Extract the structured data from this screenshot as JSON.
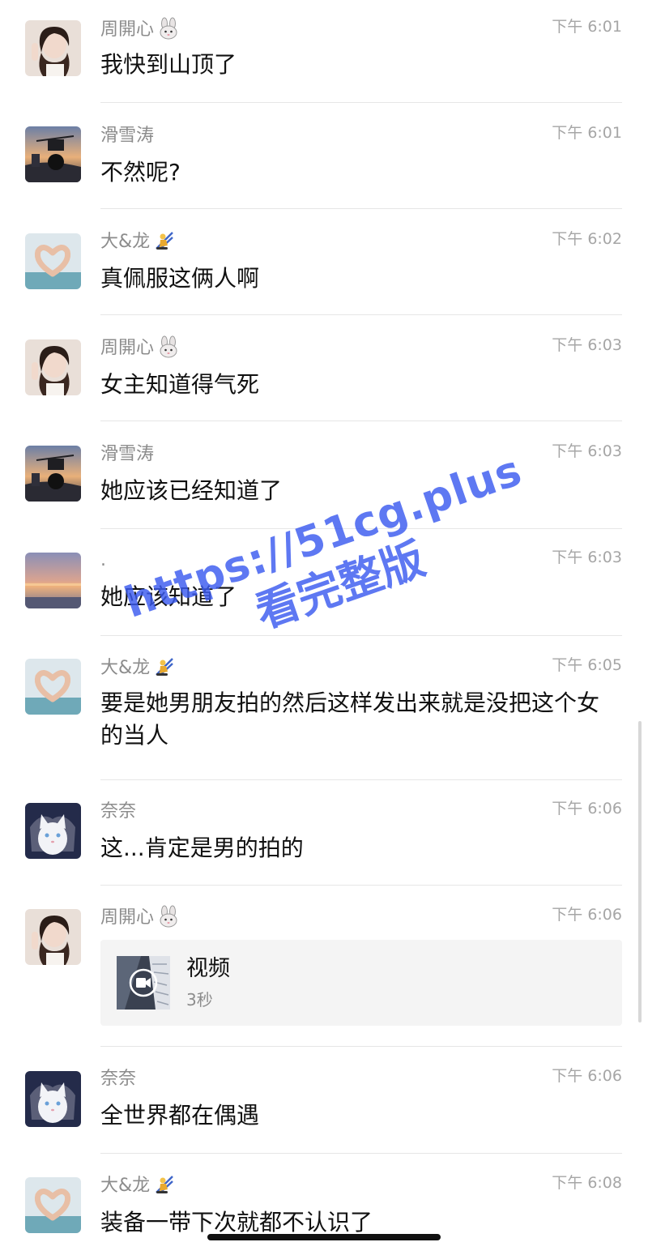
{
  "messages": [
    {
      "sender": "周開心",
      "sender_emoji": "rabbit-emoji",
      "time": "下午 6:01",
      "type": "text",
      "text": "我快到山顶了",
      "avatar": "avatar-girl"
    },
    {
      "sender": "滑雪涛",
      "sender_emoji": "",
      "time": "下午 6:01",
      "type": "text",
      "text": "不然呢?",
      "avatar": "avatar-ski-sunset"
    },
    {
      "sender": "大&龙",
      "sender_emoji": "skier-emoji",
      "time": "下午 6:02",
      "type": "text",
      "text": "真佩服这俩人啊",
      "avatar": "avatar-heart-hands"
    },
    {
      "sender": "周開心",
      "sender_emoji": "rabbit-emoji",
      "time": "下午 6:03",
      "type": "text",
      "text": "女主知道得气死",
      "avatar": "avatar-girl"
    },
    {
      "sender": "滑雪涛",
      "sender_emoji": "",
      "time": "下午 6:03",
      "type": "text",
      "text": "她应该已经知道了",
      "avatar": "avatar-ski-sunset"
    },
    {
      "sender": ".",
      "sender_emoji": "",
      "time": "下午 6:03",
      "type": "text",
      "text": "她应该知道了",
      "avatar": "avatar-sunset-sea"
    },
    {
      "sender": "大&龙",
      "sender_emoji": "skier-emoji",
      "time": "下午 6:05",
      "type": "text",
      "text": "要是她男朋友拍的然后这样发出来就是没把这个女的当人",
      "avatar": "avatar-heart-hands"
    },
    {
      "sender": "奈奈",
      "sender_emoji": "",
      "time": "下午 6:06",
      "type": "text",
      "text": "这...肯定是男的拍的",
      "avatar": "avatar-white-cat"
    },
    {
      "sender": "周開心",
      "sender_emoji": "rabbit-emoji",
      "time": "下午 6:06",
      "type": "video",
      "video_title": "视频",
      "video_duration": "3秒",
      "avatar": "avatar-girl"
    },
    {
      "sender": "奈奈",
      "sender_emoji": "",
      "time": "下午 6:06",
      "type": "text",
      "text": "全世界都在偶遇",
      "avatar": "avatar-white-cat"
    },
    {
      "sender": "大&龙",
      "sender_emoji": "skier-emoji",
      "time": "下午 6:08",
      "type": "text",
      "text": "装备一带下次就都不认识了",
      "avatar": "avatar-heart-hands"
    }
  ],
  "watermark": {
    "url": "https://51cg.plus",
    "subtitle": "看完整版",
    "color": "#3b5bf0"
  },
  "colors": {
    "sender_name": "#8c8c8c",
    "timestamp": "#a6a6a6",
    "message_text": "#111111",
    "divider": "#e6e6e6",
    "video_card_bg": "#f4f4f4"
  }
}
